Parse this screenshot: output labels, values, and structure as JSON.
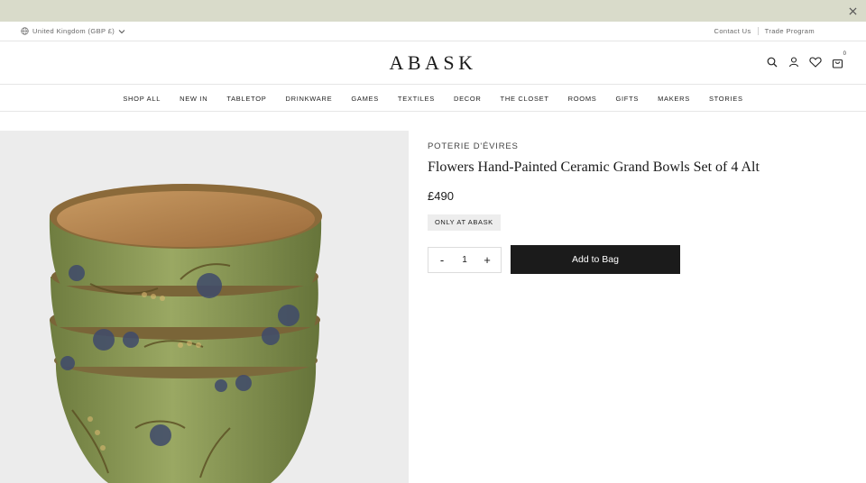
{
  "promo": {
    "close_icon": "close-icon"
  },
  "utility": {
    "locale": "United Kingdom (GBP £)",
    "contact": "Contact Us",
    "trade": "Trade Program"
  },
  "header": {
    "logo": "ABASK",
    "bag_count": "0",
    "icons": [
      "search-icon",
      "account-icon",
      "heart-icon",
      "bag-icon"
    ]
  },
  "nav": {
    "items": [
      "SHOP ALL",
      "NEW IN",
      "TABLETOP",
      "DRINKWARE",
      "GAMES",
      "TEXTILES",
      "DECOR",
      "THE CLOSET",
      "ROOMS",
      "GIFTS",
      "MAKERS",
      "STORIES"
    ]
  },
  "product": {
    "brand": "POTERIE D'ÉVIRES",
    "title": "Flowers Hand-Painted Ceramic Grand Bowls Set of 4 Alt",
    "price": "£490",
    "badge": "ONLY AT ABASK",
    "qty_minus": "-",
    "qty_value": "1",
    "qty_plus": "+",
    "add_to_bag": "Add to Bag"
  },
  "colors": {
    "promo_bar": "#d9dbca",
    "button": "#1b1b1b",
    "image_bg": "#ececec",
    "bowl_green": "#8a9a55",
    "bowl_inner": "#b98a55"
  }
}
